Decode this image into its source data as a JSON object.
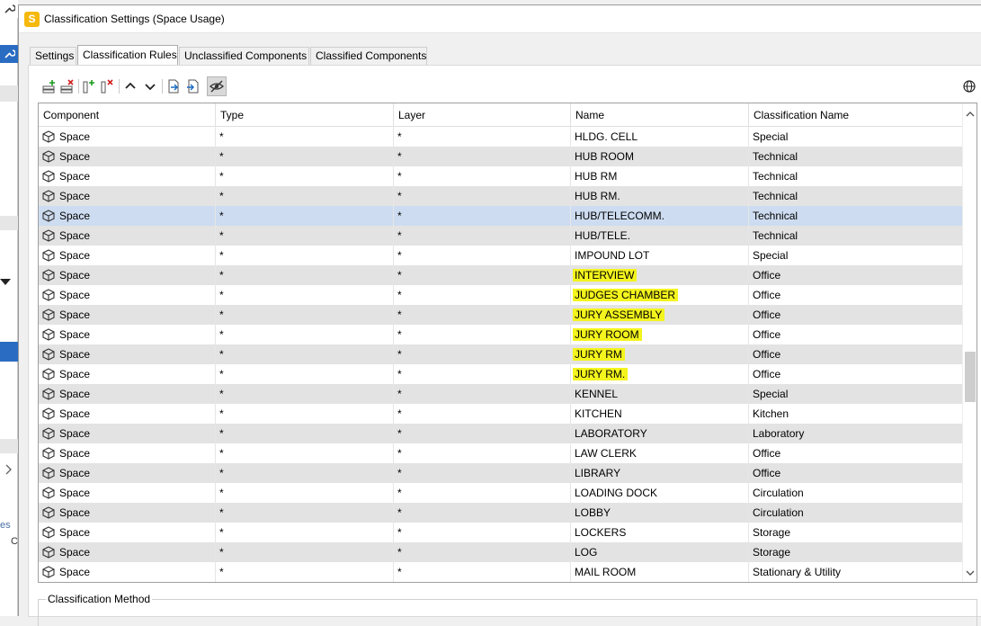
{
  "window": {
    "title": "Classification Settings (Space Usage)",
    "app_icon_letter": "S"
  },
  "tabs": [
    {
      "label": "Settings",
      "active": false
    },
    {
      "label": "Classification Rules",
      "active": true
    },
    {
      "label": "Unclassified Components",
      "active": false
    },
    {
      "label": "Classified Components",
      "active": false
    }
  ],
  "toolbar": {
    "buttons": [
      "add-row-icon",
      "delete-row-icon",
      "add-column-icon",
      "delete-column-icon",
      "move-up-icon",
      "move-down-icon",
      "export-icon",
      "import-icon",
      "visibility-toggle-icon"
    ]
  },
  "grid": {
    "columns": [
      "Component",
      "Type",
      "Layer",
      "Name",
      "Classification Name"
    ],
    "rows": [
      {
        "component": "Space",
        "type": "*",
        "layer": "*",
        "name": "HLDG. CELL",
        "classification": "Special",
        "highlighted": false
      },
      {
        "component": "Space",
        "type": "*",
        "layer": "*",
        "name": "HUB ROOM",
        "classification": "Technical",
        "highlighted": false
      },
      {
        "component": "Space",
        "type": "*",
        "layer": "*",
        "name": "HUB RM",
        "classification": "Technical",
        "highlighted": false
      },
      {
        "component": "Space",
        "type": "*",
        "layer": "*",
        "name": "HUB RM.",
        "classification": "Technical",
        "highlighted": false
      },
      {
        "component": "Space",
        "type": "*",
        "layer": "*",
        "name": "HUB/TELECOMM.",
        "classification": "Technical",
        "highlighted": false,
        "selected": true
      },
      {
        "component": "Space",
        "type": "*",
        "layer": "*",
        "name": "HUB/TELE.",
        "classification": "Technical",
        "highlighted": false
      },
      {
        "component": "Space",
        "type": "*",
        "layer": "*",
        "name": "IMPOUND LOT",
        "classification": "Special",
        "highlighted": false
      },
      {
        "component": "Space",
        "type": "*",
        "layer": "*",
        "name": "INTERVIEW",
        "classification": "Office",
        "highlighted": true
      },
      {
        "component": "Space",
        "type": "*",
        "layer": "*",
        "name": "JUDGES CHAMBER",
        "classification": "Office",
        "highlighted": true
      },
      {
        "component": "Space",
        "type": "*",
        "layer": "*",
        "name": "JURY ASSEMBLY",
        "classification": "Office",
        "highlighted": true
      },
      {
        "component": "Space",
        "type": "*",
        "layer": "*",
        "name": "JURY ROOM",
        "classification": "Office",
        "highlighted": true
      },
      {
        "component": "Space",
        "type": "*",
        "layer": "*",
        "name": "JURY RM",
        "classification": "Office",
        "highlighted": true
      },
      {
        "component": "Space",
        "type": "*",
        "layer": "*",
        "name": "JURY RM.",
        "classification": "Office",
        "highlighted": true
      },
      {
        "component": "Space",
        "type": "*",
        "layer": "*",
        "name": "KENNEL",
        "classification": "Special",
        "highlighted": false
      },
      {
        "component": "Space",
        "type": "*",
        "layer": "*",
        "name": "KITCHEN",
        "classification": "Kitchen",
        "highlighted": false
      },
      {
        "component": "Space",
        "type": "*",
        "layer": "*",
        "name": "LABORATORY",
        "classification": "Laboratory",
        "highlighted": false
      },
      {
        "component": "Space",
        "type": "*",
        "layer": "*",
        "name": "LAW CLERK",
        "classification": "Office",
        "highlighted": false
      },
      {
        "component": "Space",
        "type": "*",
        "layer": "*",
        "name": "LIBRARY",
        "classification": "Office",
        "highlighted": false
      },
      {
        "component": "Space",
        "type": "*",
        "layer": "*",
        "name": "LOADING DOCK",
        "classification": "Circulation",
        "highlighted": false
      },
      {
        "component": "Space",
        "type": "*",
        "layer": "*",
        "name": "LOBBY",
        "classification": "Circulation",
        "highlighted": false
      },
      {
        "component": "Space",
        "type": "*",
        "layer": "*",
        "name": "LOCKERS",
        "classification": "Storage",
        "highlighted": false
      },
      {
        "component": "Space",
        "type": "*",
        "layer": "*",
        "name": "LOG",
        "classification": "Storage",
        "highlighted": false
      },
      {
        "component": "Space",
        "type": "*",
        "layer": "*",
        "name": "MAIL ROOM",
        "classification": "Stationary & Utility",
        "highlighted": false
      }
    ]
  },
  "classification_method": {
    "label": "Classification Method"
  },
  "background_app": {
    "fragments": [
      "es",
      "C"
    ]
  },
  "colors": {
    "highlight": "#f4f41e",
    "selected_row": "#cddcf0",
    "alt_row": "#e3e3e3",
    "app_icon": "#f5b80b"
  }
}
